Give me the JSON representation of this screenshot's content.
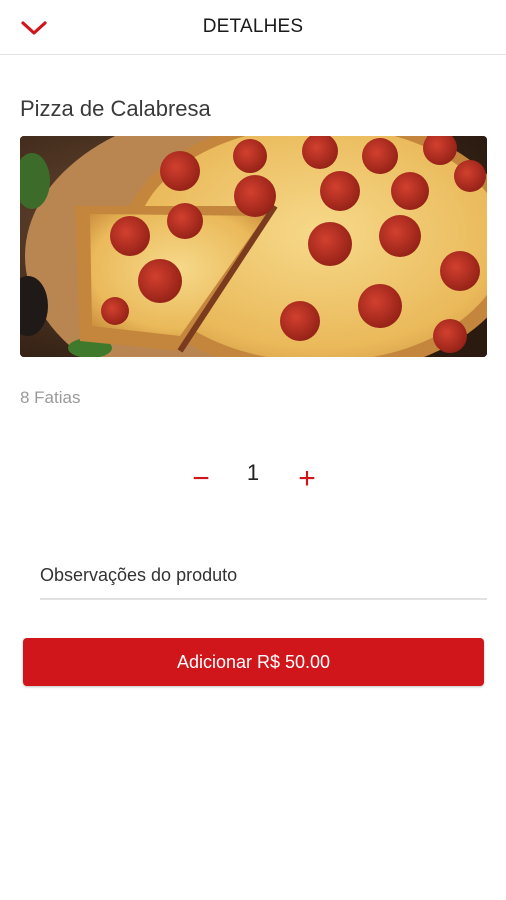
{
  "header": {
    "title": "DETALHES",
    "back_icon": "chevron-down-icon"
  },
  "product": {
    "name": "Pizza de Calabresa",
    "image_alt": "pizza-photo",
    "portion": "8 Fatias"
  },
  "quantity": {
    "minus_label": "−",
    "value": "1",
    "plus_label": "+"
  },
  "notes": {
    "placeholder": "Observações do produto",
    "value": ""
  },
  "actions": {
    "add_label": "Adicionar R$ 50.00"
  },
  "colors": {
    "accent": "#d0161b",
    "divider": "#e1e1e1",
    "muted_text": "#9a9a9a"
  }
}
